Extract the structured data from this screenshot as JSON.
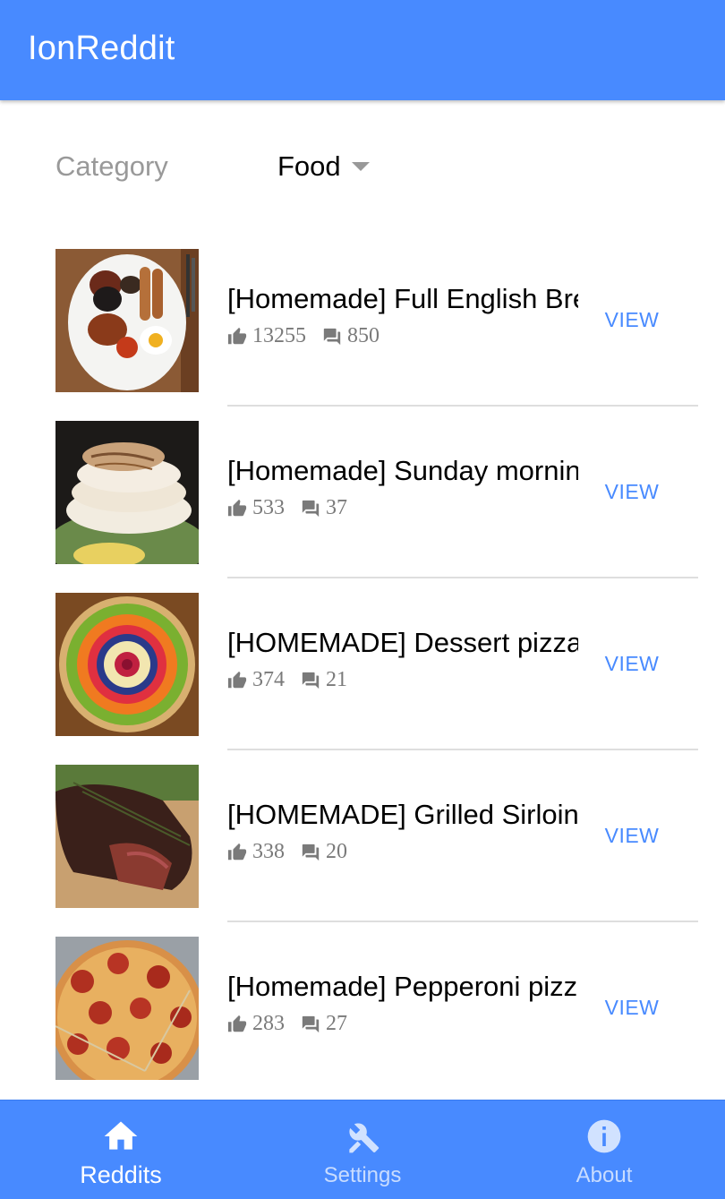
{
  "app": {
    "title": "IonReddit"
  },
  "filter": {
    "label": "Category",
    "selected": "Food"
  },
  "posts": [
    {
      "title": "[Homemade] Full English Breakfast",
      "likes": "13255",
      "comments": "850",
      "action": "VIEW",
      "image": "full-english-breakfast"
    },
    {
      "title": "[Homemade] Sunday morning pancakes",
      "likes": "533",
      "comments": "37",
      "action": "VIEW",
      "image": "pancakes"
    },
    {
      "title": "[HOMEMADE] Dessert pizza",
      "likes": "374",
      "comments": "21",
      "action": "VIEW",
      "image": "dessert-pizza"
    },
    {
      "title": "[HOMEMADE] Grilled Sirloin",
      "likes": "338",
      "comments": "20",
      "action": "VIEW",
      "image": "grilled-sirloin"
    },
    {
      "title": "[Homemade] Pepperoni pizza",
      "likes": "283",
      "comments": "27",
      "action": "VIEW",
      "image": "pepperoni-pizza"
    }
  ],
  "tabs": [
    {
      "label": "Reddits",
      "icon": "home-icon",
      "active": true
    },
    {
      "label": "Settings",
      "icon": "tools-icon",
      "active": false
    },
    {
      "label": "About",
      "icon": "info-icon",
      "active": false
    }
  ],
  "colors": {
    "primary": "#488aff",
    "muted": "#999999"
  }
}
